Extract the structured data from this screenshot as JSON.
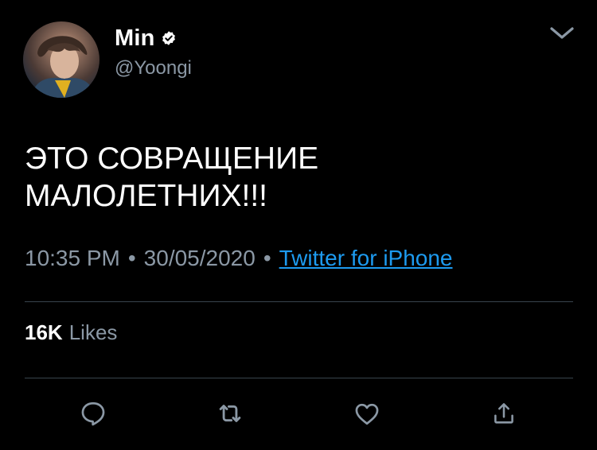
{
  "user": {
    "display_name": "Min",
    "handle": "@Yoongi",
    "verified": true,
    "avatar_icon": "profile-photo"
  },
  "tweet": {
    "text": "ЭТО СОВРАЩЕНИЕ\nМАЛОЛЕТНИХ!!!",
    "time": "10:35 PM",
    "separator": "•",
    "date": "30/05/2020",
    "source": "Twitter for iPhone"
  },
  "stats": {
    "likes_count": "16K",
    "likes_label": "Likes"
  },
  "actions": {
    "reply_icon": "reply-icon",
    "retweet_icon": "retweet-icon",
    "like_icon": "heart-icon",
    "share_icon": "share-icon",
    "menu_icon": "chevron-down-icon"
  },
  "colors": {
    "background": "#000000",
    "text_primary": "#ffffff",
    "text_secondary": "#8b98a5",
    "link": "#1d9bf0",
    "divider": "#38444d"
  }
}
